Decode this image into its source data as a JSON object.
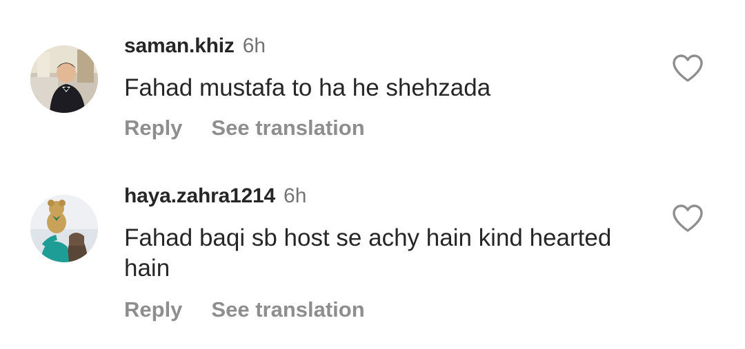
{
  "comments": [
    {
      "username": "saman.khiz",
      "time": "6h",
      "text": "Fahad mustafa to ha he shehzada",
      "reply_label": "Reply",
      "translate_label": "See translation",
      "like_icon": "heart-outline-icon"
    },
    {
      "username": "haya.zahra1214",
      "time": "6h",
      "text": "Fahad baqi sb host se achy hain kind hearted hain",
      "reply_label": "Reply",
      "translate_label": "See translation",
      "like_icon": "heart-outline-icon"
    }
  ],
  "colors": {
    "text_primary": "#262626",
    "text_secondary": "#737373",
    "action_text": "#8e8e8e",
    "icon_stroke": "#8e8e8e"
  }
}
